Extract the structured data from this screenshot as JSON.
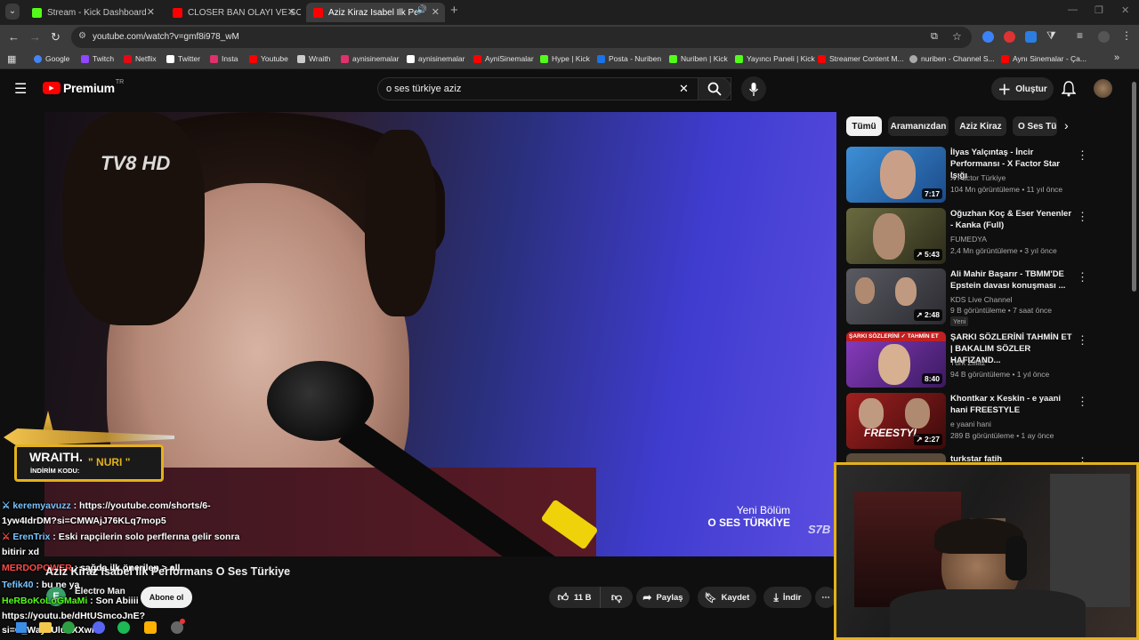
{
  "tabs": [
    {
      "title": "Stream - Kick Dashboard",
      "favicon_color": "#53fc18"
    },
    {
      "title": "CLOSER BAN OLAYI VE SONRA",
      "favicon_color": "#ff0000"
    },
    {
      "title": "Aziz Kiraz Isabel İlk Perform",
      "favicon_color": "#ff0000",
      "active": true
    }
  ],
  "new_tab_label": "+",
  "address_bar": {
    "url": "youtube.com/watch?v=gmf8i978_wM"
  },
  "bookmarks": [
    {
      "label": "Google",
      "color": "#4285f4"
    },
    {
      "label": "Twitch",
      "color": "#9146ff"
    },
    {
      "label": "Netflix",
      "color": "#e50914"
    },
    {
      "label": "Twitter",
      "color": "#ffffff"
    },
    {
      "label": "Insta",
      "color": "#e1306c"
    },
    {
      "label": "Youtube",
      "color": "#ff0000"
    },
    {
      "label": "Wraith",
      "color": "#cccccc"
    },
    {
      "label": "aynisinemalar",
      "color": "#e1306c"
    },
    {
      "label": "aynisinemalar",
      "color": "#ffffff"
    },
    {
      "label": "AyniSinemalar",
      "color": "#ff0000"
    },
    {
      "label": "Hype | Kick",
      "color": "#53fc18"
    },
    {
      "label": "Posta - Nuriben",
      "color": "#1a73e8"
    },
    {
      "label": "Nuriben | Kick",
      "color": "#53fc18"
    },
    {
      "label": "Yayıncı Paneli | Kick",
      "color": "#53fc18"
    },
    {
      "label": "Streamer Content M...",
      "color": "#ff0000"
    },
    {
      "label": "nuriben - Channel S...",
      "color": "#aaaaaa"
    },
    {
      "label": "Aynı Sinemalar - Ça...",
      "color": "#ff0000"
    }
  ],
  "youtube": {
    "logo_text": "Premium",
    "logo_sup": "TR",
    "search_value": "o ses türkiye aziz",
    "create_label": "Oluştur"
  },
  "chips": [
    "Tümü",
    "Aramanızdan",
    "Aziz Kiraz",
    "O Ses Tü"
  ],
  "recommendations": [
    {
      "title": "İlyas Yalçıntaş - İncir Performansı - X Factor Star Işığı",
      "channel": "X Factor Türkiye",
      "meta": "104 Mn görüntüleme • 11 yıl önce",
      "duration": "7:17",
      "thumb": "#3d8fd6"
    },
    {
      "title": "Oğuzhan Koç & Eser Yenenler - Kanka (Full)",
      "channel": "FUMEDYA",
      "meta": "2,4 Mn görüntüleme • 3 yıl önce",
      "duration": "5:43",
      "thumb": "#5a5a3a"
    },
    {
      "title": "Ali Mahir Başarır - TBMM'DE Epstein davası konuşması ...",
      "channel": "KDS Live Channel",
      "meta": "9 B görüntüleme • 7 saat önce",
      "duration": "2:48",
      "badge": "Yeni",
      "thumb": "#4a4a50"
    },
    {
      "title": "ŞARKI SÖZLERİNİ TAHMİN ET | BAKALIM SÖZLER HAFIZAND...",
      "channel": "Türk Zillaz",
      "meta": "94 B görüntüleme • 1 yıl önce",
      "duration": "8:40",
      "thumb": "#7a3aa8"
    },
    {
      "title": "Khontkar x Keskin - e yaani hani FREESTYLE",
      "channel": "e yaani hani",
      "meta": "289 B görüntüleme • 1 ay önce",
      "duration": "2:27",
      "thumb": "#8a1e1e"
    },
    {
      "title": "turkstar fatih",
      "channel": "",
      "meta": "",
      "duration": "",
      "thumb": "#444444"
    }
  ],
  "video": {
    "channel_watermark": "TV8 HD",
    "corner_line1": "Yeni Bölüm",
    "corner_line2": "O SES TÜRKİYE",
    "corner_logo": "S7B",
    "title": "Aziz Kiraz Isabel İlk Performans O Ses Türkiye",
    "channel_name": "Electro Man",
    "subscribe_label": "Abone ol"
  },
  "actions": {
    "likes": "11 B",
    "share": "Paylaş",
    "save": "Kaydet",
    "download": "İndir",
    "more": "⋯"
  },
  "sponsor": {
    "brand": "WRAITH.",
    "code_label": "İNDİRİM KODU:",
    "code": "\" NURI \""
  },
  "chat": [
    {
      "user": "keremyavuzz",
      "user_color": "#7ac5ff",
      "text": ": https://youtube.com/shorts/6-",
      "cont": "1yw4IdrDM?si=CMWAjJ76KLq7mop5"
    },
    {
      "user": "ErenTrix",
      "user_color": "#7ac5ff",
      "text": ": Eski rapçilerin solo perflerına gelir sonra",
      "cont": "bitirir xd"
    },
    {
      "user": "MERDOPOWER",
      "user_color": "#ff4a4a",
      "text": ": sağda ilk önerilen > all"
    },
    {
      "user": "Tefik40",
      "user_color": "#7ac5ff",
      "text": ": bu ne ya"
    },
    {
      "user": "HeRBoKoLoGMaMi",
      "user_color": "#53fc18",
      "text": ": Son Abiiii"
    },
    {
      "user": "",
      "user_color": "#ffffff",
      "text": "https://youtu.be/dHtUSmcoJnE?",
      "cont": "si=C_WaysUluFXXwm"
    }
  ]
}
